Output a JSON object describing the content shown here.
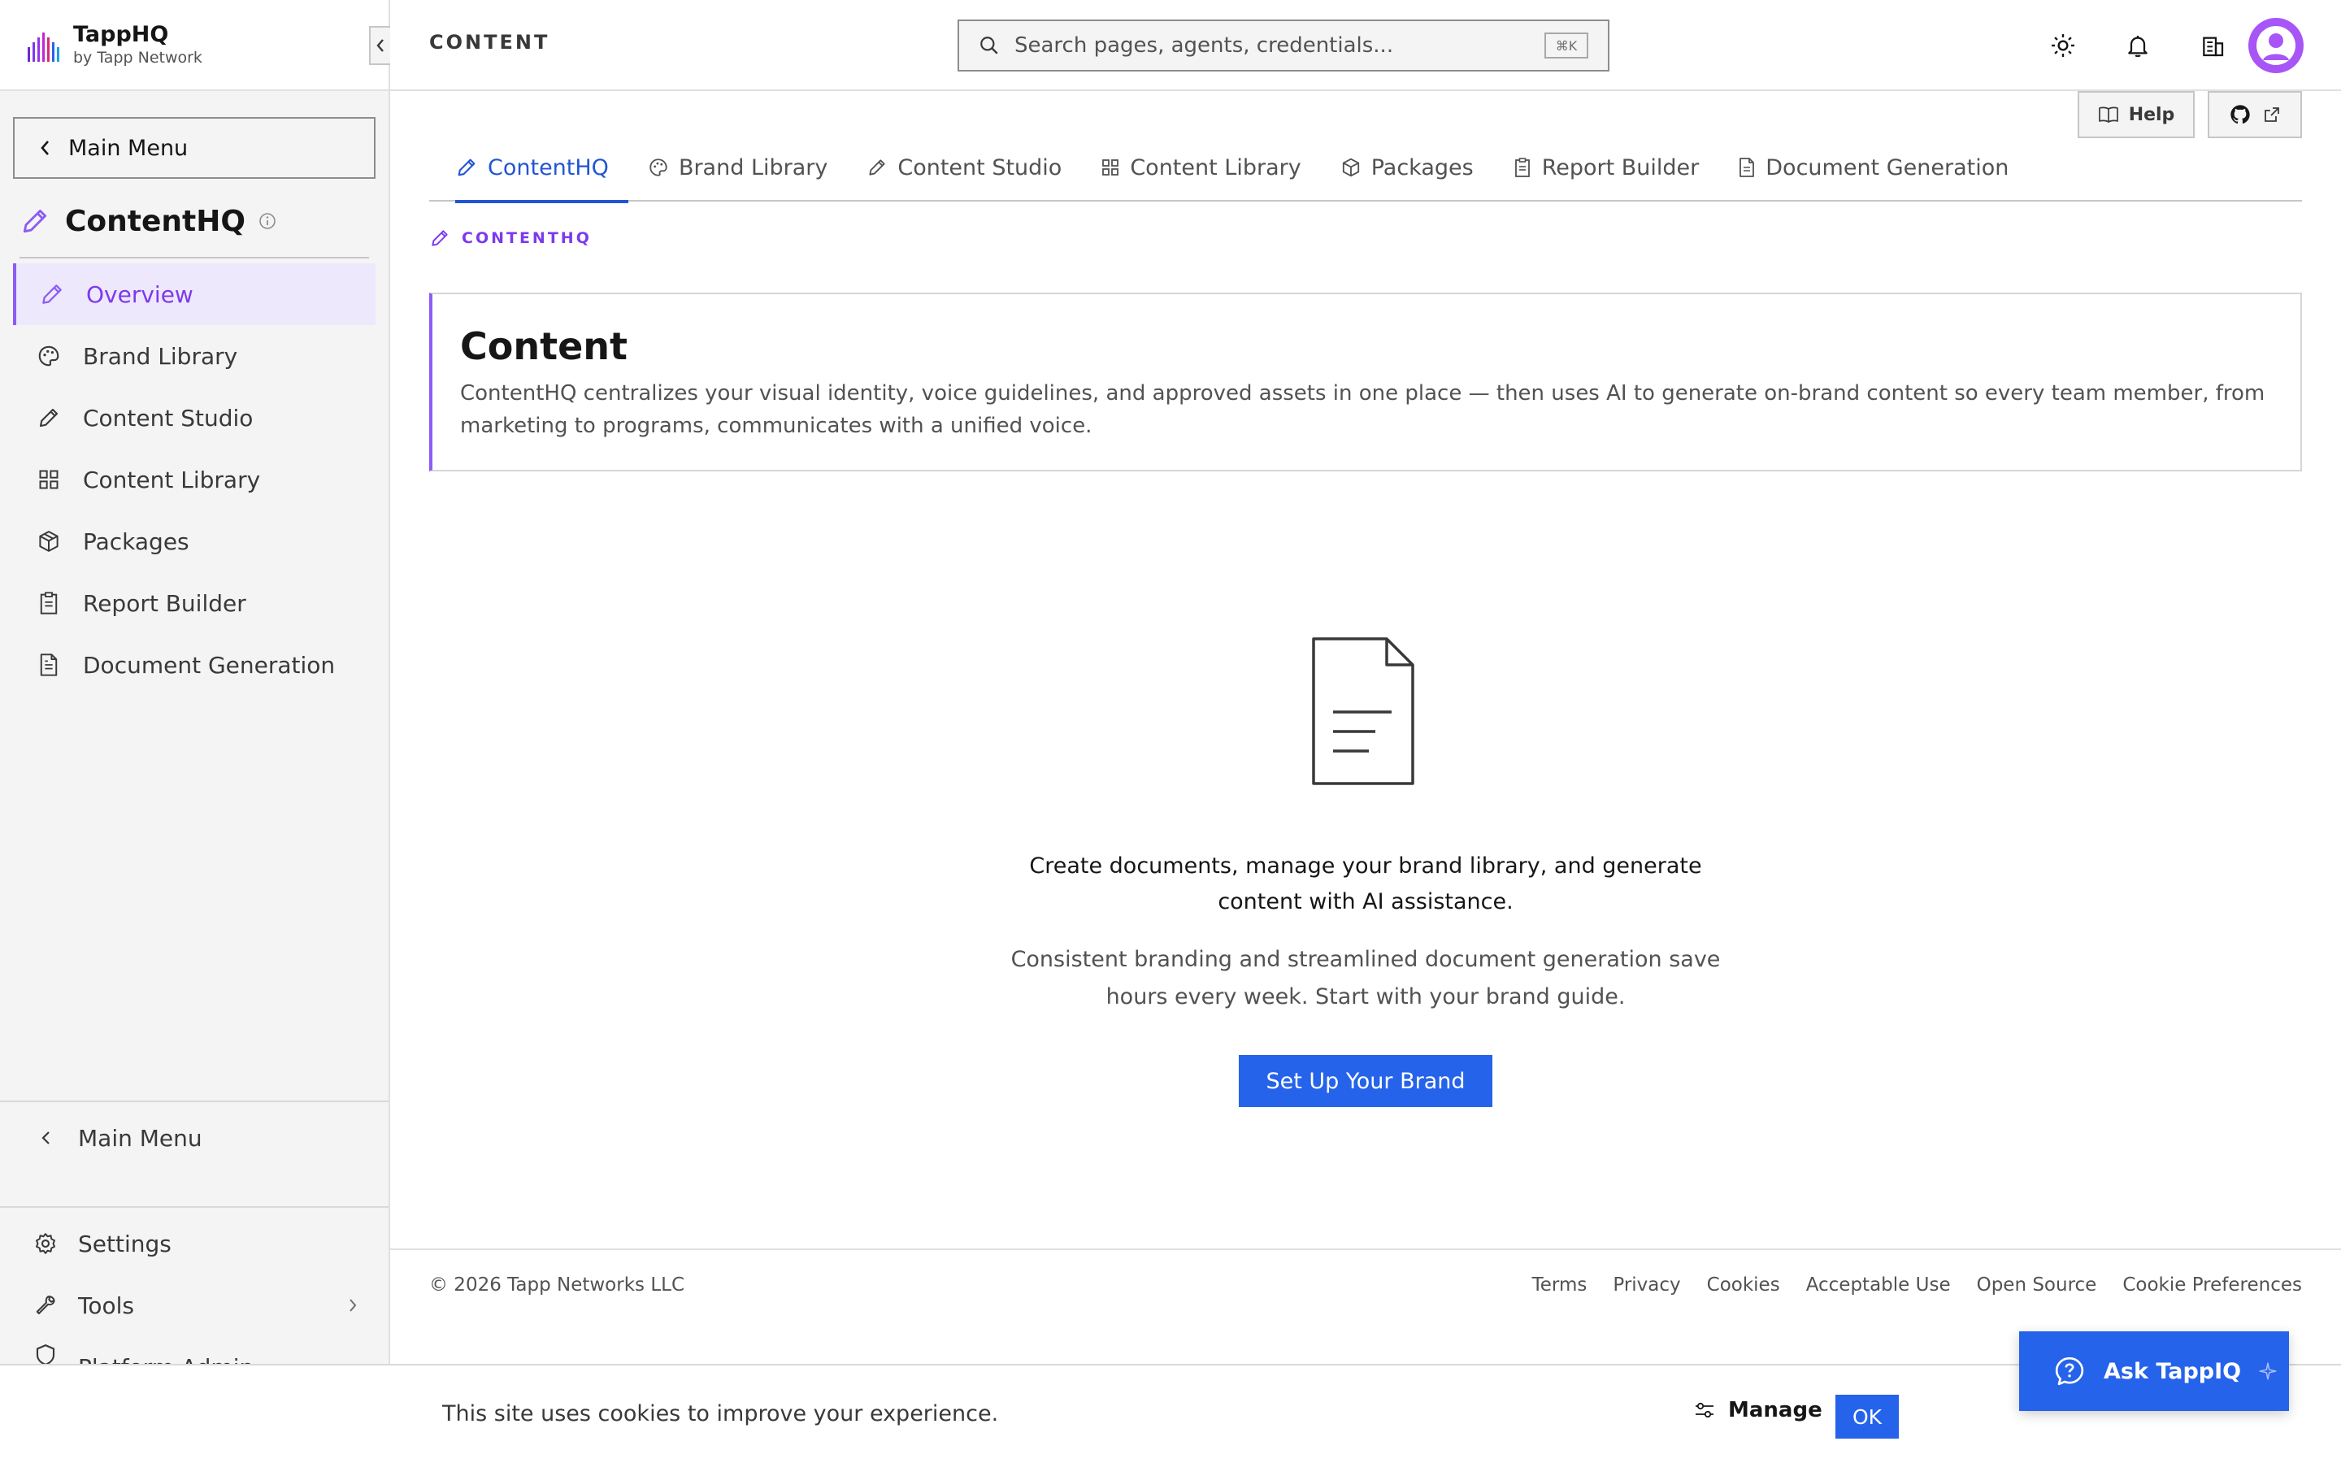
{
  "brand": {
    "name": "TappHQ",
    "subtitle": "by Tapp Network"
  },
  "sidebar": {
    "main_menu_label": "Main Menu",
    "section_title": "ContentHQ",
    "items": [
      {
        "label": "Overview",
        "icon": "pencil-icon",
        "active": true
      },
      {
        "label": "Brand Library",
        "icon": "palette-icon"
      },
      {
        "label": "Content Studio",
        "icon": "pencil-icon"
      },
      {
        "label": "Content Library",
        "icon": "grid-icon"
      },
      {
        "label": "Packages",
        "icon": "package-icon"
      },
      {
        "label": "Report Builder",
        "icon": "clipboard-icon"
      },
      {
        "label": "Document Generation",
        "icon": "document-icon"
      }
    ],
    "back_label": "Main Menu",
    "settings_label": "Settings",
    "tools_label": "Tools",
    "platform_admin_label": "Platform Admin"
  },
  "header": {
    "page_label": "CONTENT",
    "search_placeholder": "Search pages, agents, credentials...",
    "search_shortcut": "⌘K"
  },
  "help": {
    "label": "Help"
  },
  "tabs": [
    {
      "label": "ContentHQ",
      "active": true
    },
    {
      "label": "Brand Library"
    },
    {
      "label": "Content Studio"
    },
    {
      "label": "Content Library"
    },
    {
      "label": "Packages"
    },
    {
      "label": "Report Builder"
    },
    {
      "label": "Document Generation"
    }
  ],
  "breadcrumb": "CONTENTHQ",
  "hero": {
    "title": "Content",
    "description": "ContentHQ centralizes your visual identity, voice guidelines, and approved assets in one place — then uses AI to generate on-brand content so every team member, from marketing to programs, communicates with a unified voice."
  },
  "empty_state": {
    "title": "Create documents, manage your brand library, and generate content with AI assistance.",
    "description": "Consistent branding and streamlined document generation save hours every week. Start with your brand guide.",
    "cta": "Set Up Your Brand"
  },
  "footer": {
    "copyright": "© 2026 Tapp Networks LLC",
    "links": [
      "Terms",
      "Privacy",
      "Cookies",
      "Acceptable Use",
      "Open Source",
      "Cookie Preferences"
    ]
  },
  "cookie_bar": {
    "message": "This site uses cookies to improve your experience.",
    "manage_label": "Manage",
    "ok_label": "OK"
  },
  "assistant": {
    "label": "Ask TappIQ"
  },
  "colors": {
    "accent": "#2563eb",
    "brand_purple": "#8b5cf6",
    "active_bg": "#ede8fb"
  }
}
